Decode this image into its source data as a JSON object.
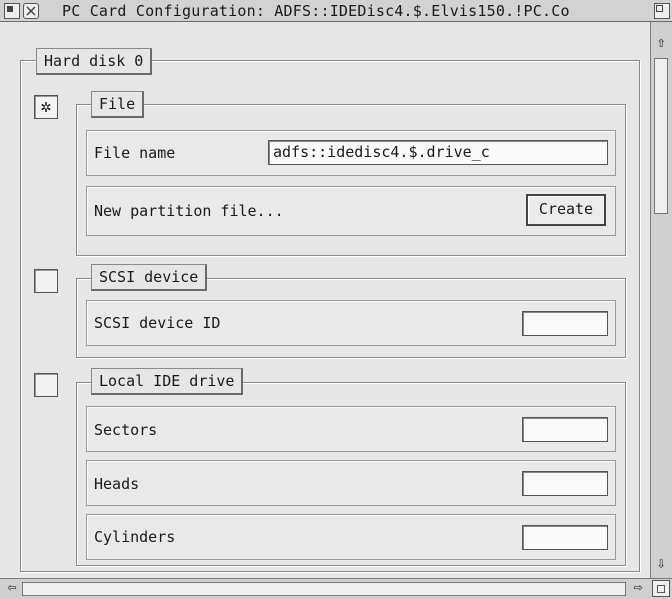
{
  "window": {
    "title": "PC Card Configuration: ADFS::IDEDisc4.$.Elvis150.!PC.Co"
  },
  "icons": {
    "back": "back-icon",
    "close": "close-icon",
    "toggle": "toggle-size-icon",
    "up": "up-arrow-icon",
    "down": "down-arrow-icon",
    "left": "left-arrow-icon",
    "right": "right-arrow-icon",
    "resize": "resize-icon"
  },
  "harddisk": {
    "label": "Hard disk 0"
  },
  "file": {
    "checked": true,
    "check_glyph": "✲",
    "label": "File",
    "filename_label": "File name",
    "filename_value": "adfs::idedisc4.$.drive_c",
    "new_partition_label": "New partition file...",
    "create_label": "Create"
  },
  "scsi": {
    "checked": false,
    "label": "SCSI device",
    "id_label": "SCSI device ID",
    "id_value": ""
  },
  "ide": {
    "checked": false,
    "label": "Local IDE drive",
    "sectors_label": "Sectors",
    "sectors_value": "",
    "heads_label": "Heads",
    "heads_value": "",
    "cylinders_label": "Cylinders",
    "cylinders_value": ""
  },
  "glyphs": {
    "up": "⇧",
    "down": "⇩",
    "left": "⇦",
    "right": "⇨"
  }
}
